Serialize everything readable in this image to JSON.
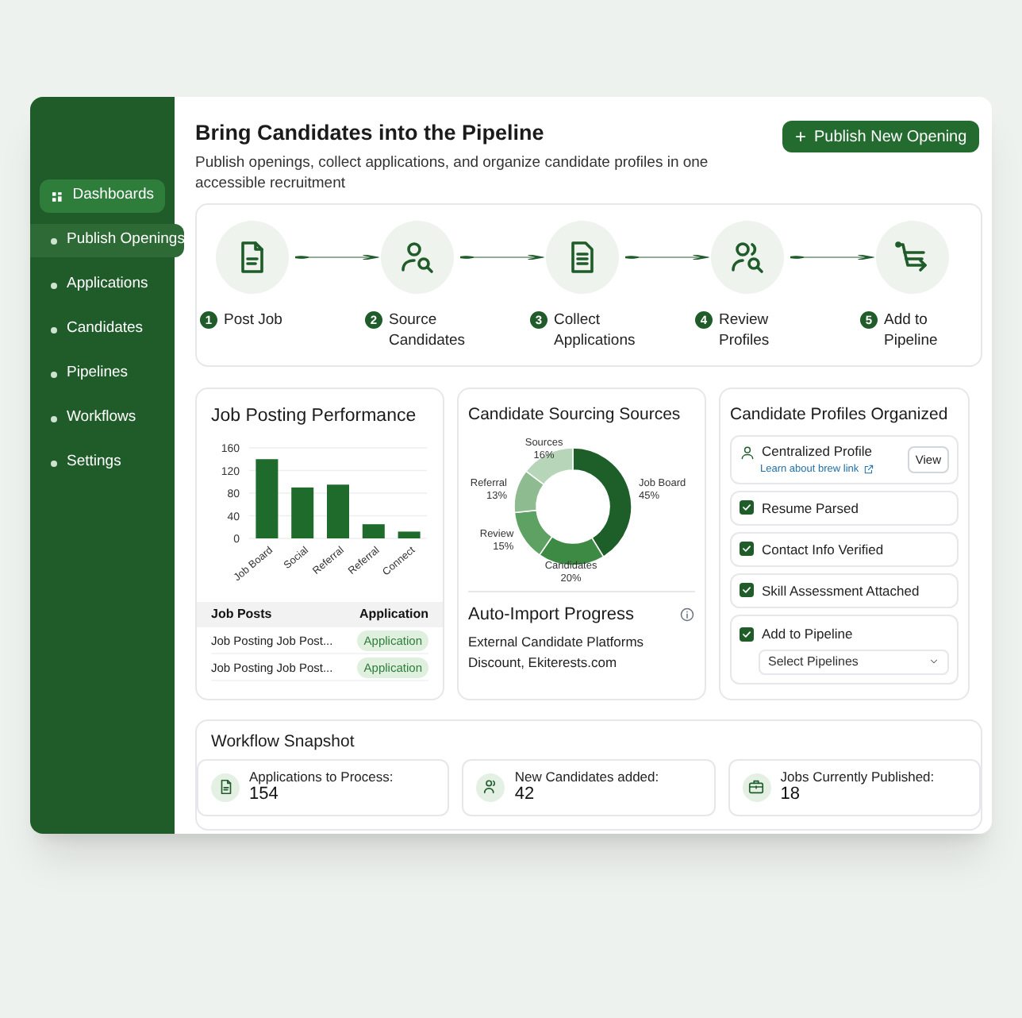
{
  "sidebar": {
    "items": [
      {
        "label": "Dashboards",
        "selected": true,
        "highlighted": false
      },
      {
        "label": "Publish Openings",
        "selected": false,
        "highlighted": true
      },
      {
        "label": "Applications",
        "selected": false,
        "highlighted": false
      },
      {
        "label": "Candidates",
        "selected": false,
        "highlighted": false
      },
      {
        "label": "Pipelines",
        "selected": false,
        "highlighted": false
      },
      {
        "label": "Workflows",
        "selected": false,
        "highlighted": false
      },
      {
        "label": "Settings",
        "selected": false,
        "highlighted": false
      }
    ]
  },
  "header": {
    "title": "Bring Candidates into the Pipeline",
    "subtitle": "Publish openings, collect applications, and organize candidate profiles in one accessible recruitment",
    "button": {
      "icon": "+",
      "label": "Publish New Opening"
    }
  },
  "steps": [
    {
      "number": "1",
      "label": "Post Job",
      "kind": "document"
    },
    {
      "number": "2",
      "label": "Source Candidates",
      "kind": "person-search"
    },
    {
      "number": "3",
      "label": "Collect Applications",
      "kind": "list"
    },
    {
      "number": "4",
      "label": "Review Profiles",
      "kind": "people-search"
    },
    {
      "number": "5",
      "label": "Add to Pipeline",
      "kind": "cart"
    }
  ],
  "performance": {
    "title": "Job Posting Performance",
    "chart_data": {
      "type": "bar",
      "categories": [
        "Job Board",
        "Social",
        "Referral",
        "Referral",
        "Connect"
      ],
      "values": [
        140,
        90,
        95,
        25,
        12
      ],
      "ylim": [
        0,
        160
      ],
      "grid": true,
      "yticks": [
        0,
        40,
        80,
        120,
        160
      ]
    },
    "table": {
      "columns": [
        "Job Posts",
        "Application"
      ],
      "rows": [
        {
          "post": "Job Posting Job Post...",
          "status": "Application"
        },
        {
          "post": "Job Posting Job Post...",
          "status": "Application"
        }
      ]
    }
  },
  "sourcing": {
    "title": "Candidate Sourcing Sources",
    "chart_data": {
      "type": "donut",
      "categories": [
        "Job Board",
        "Candidates",
        "Review",
        "Referral",
        "Sources"
      ],
      "values": [
        45,
        20,
        15,
        13,
        16
      ],
      "value_labels": [
        "45%",
        "20%",
        "15%",
        "13%",
        "16%"
      ]
    },
    "auto_import": {
      "title": "Auto-Import Progress",
      "text": "External Candidate Platforms Discount, Ekiterests.com"
    }
  },
  "profiles": {
    "title": "Candidate Profiles Organized",
    "items": [
      {
        "kind": "profile",
        "label": "Centralized Profile",
        "link": "Learn about brew link",
        "button": "View"
      },
      {
        "kind": "check",
        "label": "Resume Parsed",
        "checked": true
      },
      {
        "kind": "check",
        "label": "Contact Info Verified",
        "checked": true
      },
      {
        "kind": "check",
        "label": "Skill Assessment Attached",
        "checked": true
      },
      {
        "kind": "select",
        "label": "Add to Pipeline",
        "checked": true,
        "placeholder": "Select Pipelines"
      }
    ]
  },
  "snapshot": {
    "title": "Workflow Snapshot",
    "stats": [
      {
        "kind": "document",
        "label": "Applications to Process:",
        "value": "154"
      },
      {
        "kind": "people",
        "label": "New Candidates added:",
        "value": "42"
      },
      {
        "kind": "briefcase",
        "label": "Jobs Currently Published:",
        "value": "18"
      }
    ]
  }
}
